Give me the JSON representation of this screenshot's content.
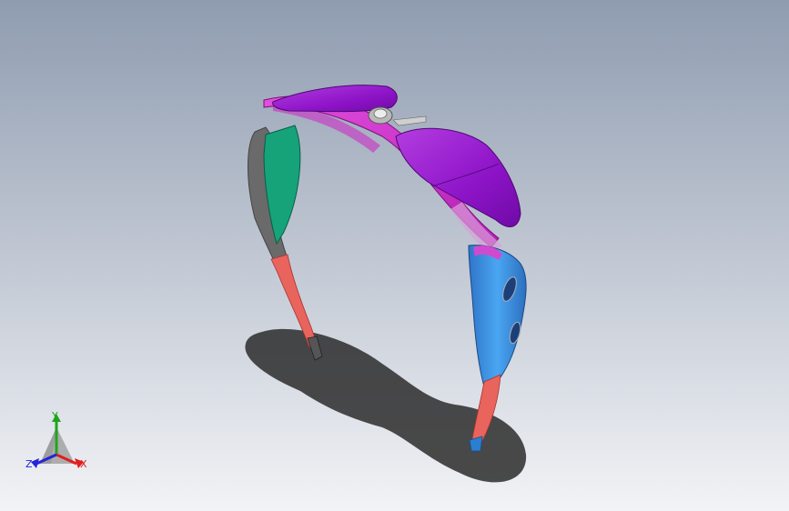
{
  "viewport": {
    "background_top": "#8f9cb0",
    "background_bottom": "#f2f3f6"
  },
  "model": {
    "name_icon": "sunglasses-frame-model",
    "colors": {
      "lens": "#9a1fd0",
      "bridge": "#d23ad0",
      "temple_left": "#1fa87a",
      "temple_right": "#3c8fe0",
      "tip": "#e8645c",
      "frame_gray": "#6f6f6f"
    }
  },
  "triad": {
    "x_label": "X",
    "y_label": "Y",
    "z_label": "Z",
    "x_color": "#e01e1e",
    "y_color": "#1ea51e",
    "z_color": "#2424d8"
  }
}
